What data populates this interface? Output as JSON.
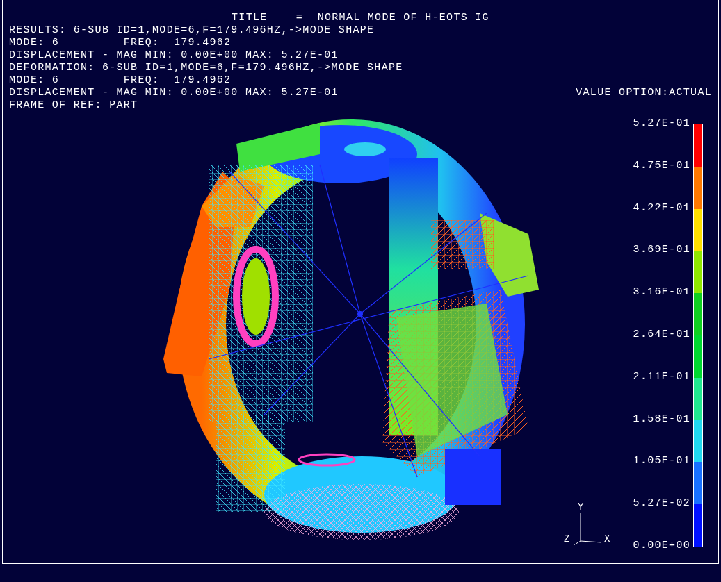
{
  "header": {
    "title": "TITLE    =  NORMAL MODE OF H-EOTS IG",
    "lines": [
      {
        "text": "RESULTS: 6-SUB ID=1,MODE=6,F=179.496HZ,->MODE SHAPE"
      },
      {
        "text": "MODE: 6         FREQ:  179.4962"
      },
      {
        "text": "DISPLACEMENT - MAG MIN: 0.00E+00 MAX: 5.27E-01"
      },
      {
        "text": "DEFORMATION: 6-SUB ID=1,MODE=6,F=179.496HZ,->MODE SHAPE"
      },
      {
        "text": "MODE: 6         FREQ:  179.4962"
      },
      {
        "text": "DISPLACEMENT - MAG MIN: 0.00E+00 MAX: 5.27E-01",
        "right": "VALUE OPTION:ACTUAL"
      },
      {
        "text": "FRAME OF REF: PART"
      }
    ]
  },
  "legend": {
    "labels": [
      "5.27E-01",
      "4.75E-01",
      "4.22E-01",
      "3.69E-01",
      "3.16E-01",
      "2.64E-01",
      "2.11E-01",
      "1.58E-01",
      "1.05E-01",
      "5.27E-02",
      "0.00E+00"
    ],
    "bands": [
      {
        "color": "#ff0000"
      },
      {
        "color": "#ff7800"
      },
      {
        "color": "#ffe000"
      },
      {
        "color": "#90e800"
      },
      {
        "color": "#10d020"
      },
      {
        "color": "#00d830"
      },
      {
        "color": "#20e890"
      },
      {
        "color": "#20d8f0"
      },
      {
        "color": "#1870ff"
      },
      {
        "color": "#0010ff"
      }
    ]
  },
  "triad": {
    "y": "Y",
    "z": "Z",
    "x": "X"
  }
}
